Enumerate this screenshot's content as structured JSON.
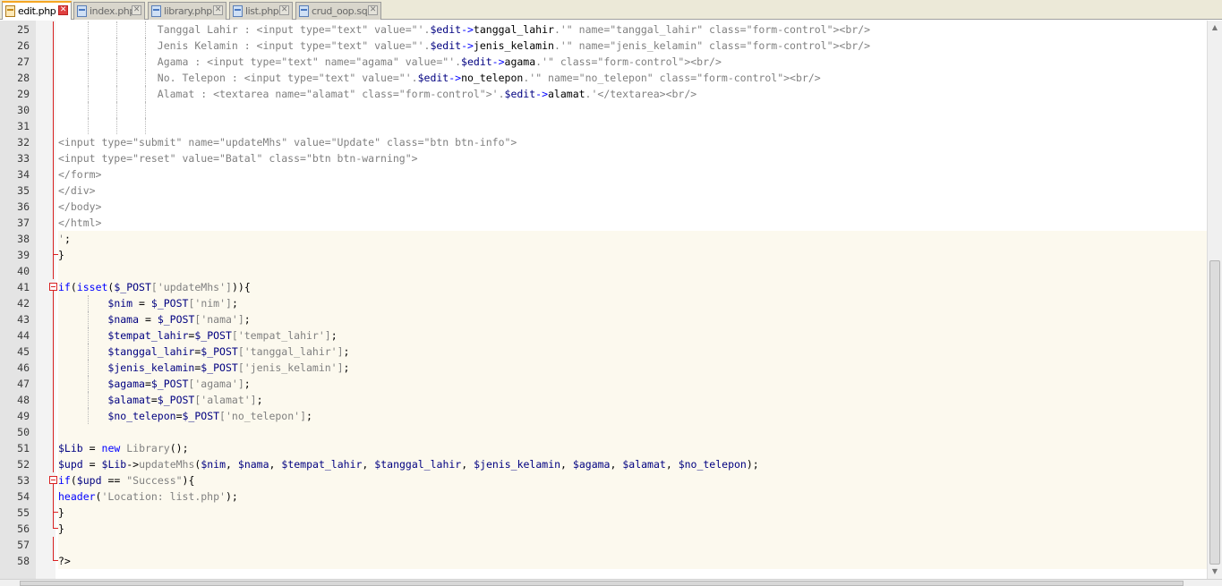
{
  "tabs": [
    {
      "label": "edit.php",
      "active": true
    },
    {
      "label": "index.php",
      "active": false
    },
    {
      "label": "library.php",
      "active": false
    },
    {
      "label": "list.php",
      "active": false
    },
    {
      "label": "crud_oop.sql",
      "active": false
    }
  ],
  "editor": {
    "lines": [
      {
        "n": "25",
        "text": "                Tanggal Lahir : <input type=\"text\" value=\"'.$edit->tanggal_lahir.'\" name=\"tanggal_lahir\" class=\"form-control\"><br/>"
      },
      {
        "n": "26",
        "text": "                Jenis Kelamin : <input type=\"text\" value=\"'.$edit->jenis_kelamin.'\" name=\"jenis_kelamin\" class=\"form-control\"><br/>"
      },
      {
        "n": "27",
        "text": "                Agama : <input type=\"text\" name=\"agama\" value=\"'.$edit->agama.'\" class=\"form-control\"><br/>"
      },
      {
        "n": "28",
        "text": "                No. Telepon : <input type=\"text\" value=\"'.$edit->no_telepon.'\" name=\"no_telepon\" class=\"form-control\"><br/>"
      },
      {
        "n": "29",
        "text": "                Alamat : <textarea name=\"alamat\" class=\"form-control\">'.$edit->alamat.'</textarea><br/>"
      },
      {
        "n": "30",
        "text": ""
      },
      {
        "n": "31",
        "text": ""
      },
      {
        "n": "32",
        "text": "<input type=\"submit\" name=\"updateMhs\" value=\"Update\" class=\"btn btn-info\">"
      },
      {
        "n": "33",
        "text": "<input type=\"reset\" value=\"Batal\" class=\"btn btn-warning\">"
      },
      {
        "n": "34",
        "text": "</form>"
      },
      {
        "n": "35",
        "text": "</div>"
      },
      {
        "n": "36",
        "text": "</body>"
      },
      {
        "n": "37",
        "text": "</html>"
      },
      {
        "n": "38",
        "text": "';"
      },
      {
        "n": "39",
        "text": "}"
      },
      {
        "n": "40",
        "text": ""
      },
      {
        "n": "41",
        "text": "if(isset($_POST['updateMhs'])){"
      },
      {
        "n": "42",
        "text": "        $nim = $_POST['nim'];"
      },
      {
        "n": "43",
        "text": "        $nama = $_POST['nama'];"
      },
      {
        "n": "44",
        "text": "        $tempat_lahir=$_POST['tempat_lahir'];"
      },
      {
        "n": "45",
        "text": "        $tanggal_lahir=$_POST['tanggal_lahir'];"
      },
      {
        "n": "46",
        "text": "        $jenis_kelamin=$_POST['jenis_kelamin'];"
      },
      {
        "n": "47",
        "text": "        $agama=$_POST['agama'];"
      },
      {
        "n": "48",
        "text": "        $alamat=$_POST['alamat'];"
      },
      {
        "n": "49",
        "text": "        $no_telepon=$_POST['no_telepon'];"
      },
      {
        "n": "50",
        "text": ""
      },
      {
        "n": "51",
        "text": "$Lib = new Library();"
      },
      {
        "n": "52",
        "text": "$upd = $Lib->updateMhs($nim, $nama, $tempat_lahir, $tanggal_lahir, $jenis_kelamin, $agama, $alamat, $no_telepon);"
      },
      {
        "n": "53",
        "text": "if($upd == \"Success\"){"
      },
      {
        "n": "54",
        "text": "header('Location: list.php');"
      },
      {
        "n": "55",
        "text": "}"
      },
      {
        "n": "56",
        "text": "}"
      },
      {
        "n": "57",
        "text": ""
      },
      {
        "n": "58",
        "text": "?>"
      }
    ]
  },
  "colors": {
    "string": "#808080",
    "keyword": "#0000ff",
    "variable": "#000080",
    "code": "#000000",
    "fold": "#d92222",
    "php_bg": "#fcf9ee"
  }
}
